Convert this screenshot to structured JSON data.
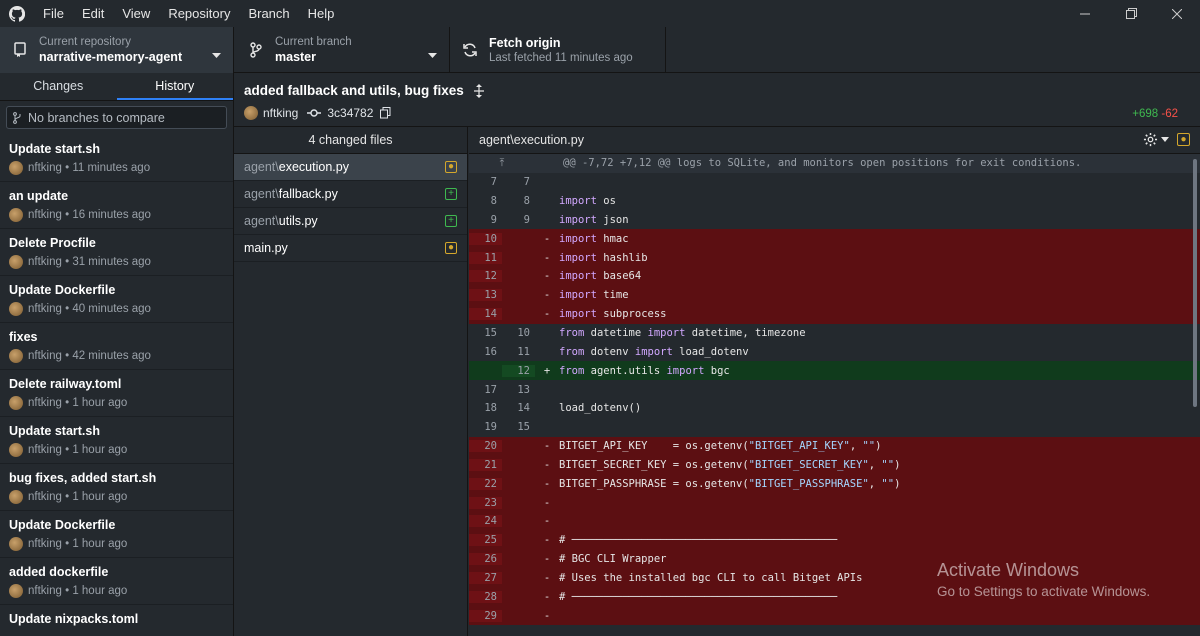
{
  "menu": [
    "File",
    "Edit",
    "View",
    "Repository",
    "Branch",
    "Help"
  ],
  "toolbar": {
    "repo_label": "Current repository",
    "repo_value": "narrative-memory-agent",
    "branch_label": "Current branch",
    "branch_value": "master",
    "fetch_label": "Fetch origin",
    "fetch_sub": "Last fetched 11 minutes ago"
  },
  "tabs": [
    "Changes",
    "History"
  ],
  "compare_placeholder": "No branches to compare",
  "commits": [
    {
      "title": "Update start.sh",
      "author": "nftking",
      "time": "11 minutes ago"
    },
    {
      "title": "an update",
      "author": "nftking",
      "time": "16 minutes ago"
    },
    {
      "title": "Delete Procfile",
      "author": "nftking",
      "time": "31 minutes ago"
    },
    {
      "title": "Update Dockerfile",
      "author": "nftking",
      "time": "40 minutes ago"
    },
    {
      "title": "fixes",
      "author": "nftking",
      "time": "42 minutes ago"
    },
    {
      "title": "Delete railway.toml",
      "author": "nftking",
      "time": "1 hour ago"
    },
    {
      "title": "Update start.sh",
      "author": "nftking",
      "time": "1 hour ago"
    },
    {
      "title": "bug fixes, added start.sh",
      "author": "nftking",
      "time": "1 hour ago"
    },
    {
      "title": "Update Dockerfile",
      "author": "nftking",
      "time": "1 hour ago"
    },
    {
      "title": "added dockerfile",
      "author": "nftking",
      "time": "1 hour ago"
    },
    {
      "title": "Update nixpacks.toml",
      "author": "nftking",
      "time": ""
    }
  ],
  "commit": {
    "title": "added fallback and utils, bug fixes",
    "author": "nftking",
    "sha": "3c34782",
    "additions": "+698",
    "deletions": "-62"
  },
  "files_header": "4 changed files",
  "files": [
    {
      "dir": "agent\\",
      "name": "execution.py",
      "status": "modified"
    },
    {
      "dir": "agent\\",
      "name": "fallback.py",
      "status": "added"
    },
    {
      "dir": "agent\\",
      "name": "utils.py",
      "status": "added"
    },
    {
      "dir": "",
      "name": "main.py",
      "status": "modified"
    }
  ],
  "diff": {
    "path": "agent\\execution.py",
    "hunk": "@@ -7,72 +7,12 @@ logs to SQLite, and monitors open positions for exit conditions.",
    "lines": [
      {
        "type": "ctx",
        "o": "7",
        "n": "7",
        "code": ""
      },
      {
        "type": "ctx",
        "o": "8",
        "n": "8",
        "code": "import os"
      },
      {
        "type": "ctx",
        "o": "9",
        "n": "9",
        "code": "import json"
      },
      {
        "type": "del",
        "o": "10",
        "n": "",
        "code": "import hmac"
      },
      {
        "type": "del",
        "o": "11",
        "n": "",
        "code": "import hashlib"
      },
      {
        "type": "del",
        "o": "12",
        "n": "",
        "code": "import base64"
      },
      {
        "type": "del",
        "o": "13",
        "n": "",
        "code": "import time"
      },
      {
        "type": "del",
        "o": "14",
        "n": "",
        "code": "import subprocess"
      },
      {
        "type": "ctx",
        "o": "15",
        "n": "10",
        "code": "from datetime import datetime, timezone"
      },
      {
        "type": "ctx",
        "o": "16",
        "n": "11",
        "code": "from dotenv import load_dotenv"
      },
      {
        "type": "add",
        "o": "",
        "n": "12",
        "code": "from agent.utils import bgc"
      },
      {
        "type": "ctx",
        "o": "17",
        "n": "13",
        "code": ""
      },
      {
        "type": "ctx",
        "o": "18",
        "n": "14",
        "code": "load_dotenv()"
      },
      {
        "type": "ctx",
        "o": "19",
        "n": "15",
        "code": ""
      },
      {
        "type": "del",
        "o": "20",
        "n": "",
        "code": "BITGET_API_KEY    = os.getenv(\"BITGET_API_KEY\", \"\")"
      },
      {
        "type": "del",
        "o": "21",
        "n": "",
        "code": "BITGET_SECRET_KEY = os.getenv(\"BITGET_SECRET_KEY\", \"\")"
      },
      {
        "type": "del",
        "o": "22",
        "n": "",
        "code": "BITGET_PASSPHRASE = os.getenv(\"BITGET_PASSPHRASE\", \"\")"
      },
      {
        "type": "del",
        "o": "23",
        "n": "",
        "code": ""
      },
      {
        "type": "del",
        "o": "24",
        "n": "",
        "code": ""
      },
      {
        "type": "del",
        "o": "25",
        "n": "",
        "code": "# ──────────────────────────────────────────"
      },
      {
        "type": "del",
        "o": "26",
        "n": "",
        "code": "# BGC CLI Wrapper"
      },
      {
        "type": "del",
        "o": "27",
        "n": "",
        "code": "# Uses the installed bgc CLI to call Bitget APIs"
      },
      {
        "type": "del",
        "o": "28",
        "n": "",
        "code": "# ──────────────────────────────────────────"
      },
      {
        "type": "del",
        "o": "29",
        "n": "",
        "code": ""
      }
    ]
  },
  "watermark": {
    "line1": "Activate Windows",
    "line2": "Go to Settings to activate Windows."
  },
  "colors": {
    "added": "#3fb950",
    "deleted": "#f85149",
    "accent": "#2f81f7"
  }
}
